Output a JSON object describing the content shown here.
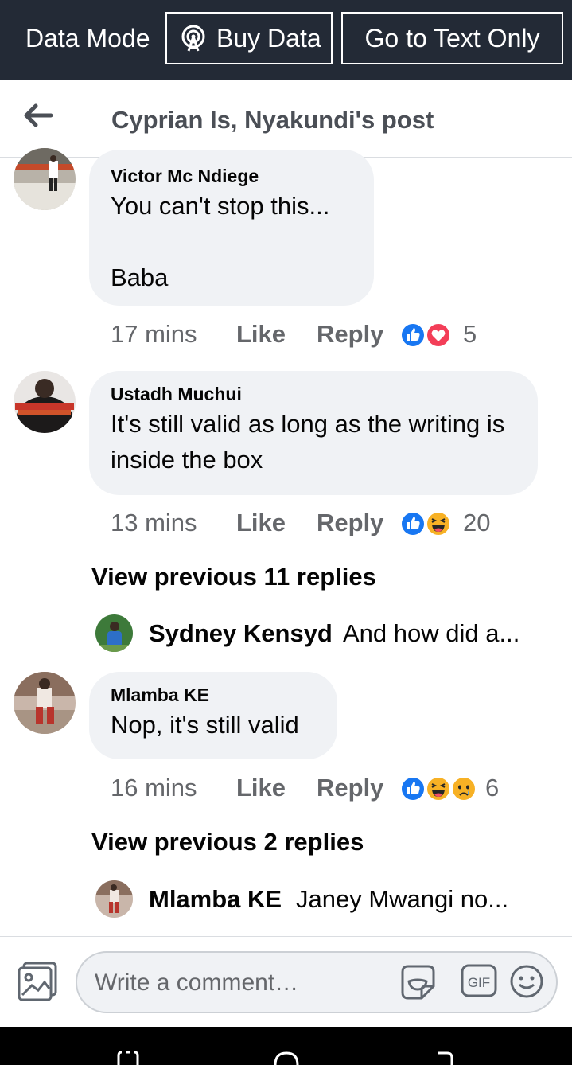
{
  "data_bar": {
    "mode_label": "Data Mode",
    "buy_data_label": "Buy Data",
    "text_only_label": "Go to Text Only"
  },
  "header": {
    "title": "Cyprian Is, Nyakundi's post",
    "back_icon": "arrow-left-icon"
  },
  "comments": [
    {
      "author": "Victor Mc Ndiege",
      "text": "You can't stop this...\n\nBaba",
      "time": "17 mins",
      "like_label": "Like",
      "reply_label": "Reply",
      "reactions": [
        "like",
        "love"
      ],
      "reaction_count": "5"
    },
    {
      "author": "Ustadh Muchui",
      "text": "It's still valid as long as the writing is inside the box",
      "time": "13 mins",
      "like_label": "Like",
      "reply_label": "Reply",
      "reactions": [
        "like",
        "haha"
      ],
      "reaction_count": "20",
      "view_previous": "View previous 11 replies",
      "reply_preview": {
        "name": "Sydney Kensyd",
        "text": "And how did a..."
      }
    },
    {
      "author": "Mlamba KE",
      "text": "Nop, it's still valid",
      "time": "16 mins",
      "like_label": "Like",
      "reply_label": "Reply",
      "reactions": [
        "like",
        "haha",
        "sad"
      ],
      "reaction_count": "6",
      "view_previous": "View previous 2 replies",
      "reply_preview": {
        "name": "Mlamba KE",
        "text": "Janey Mwangi no..."
      }
    }
  ],
  "composer": {
    "placeholder": "Write a comment…",
    "gif_label": "GIF"
  },
  "colors": {
    "data_bar_bg": "#232a36",
    "bubble_bg": "#f0f2f5",
    "like_blue": "#1877f2",
    "love_red": "#f33e58",
    "haha_yellow": "#f7b125",
    "meta_gray": "#65676b"
  }
}
